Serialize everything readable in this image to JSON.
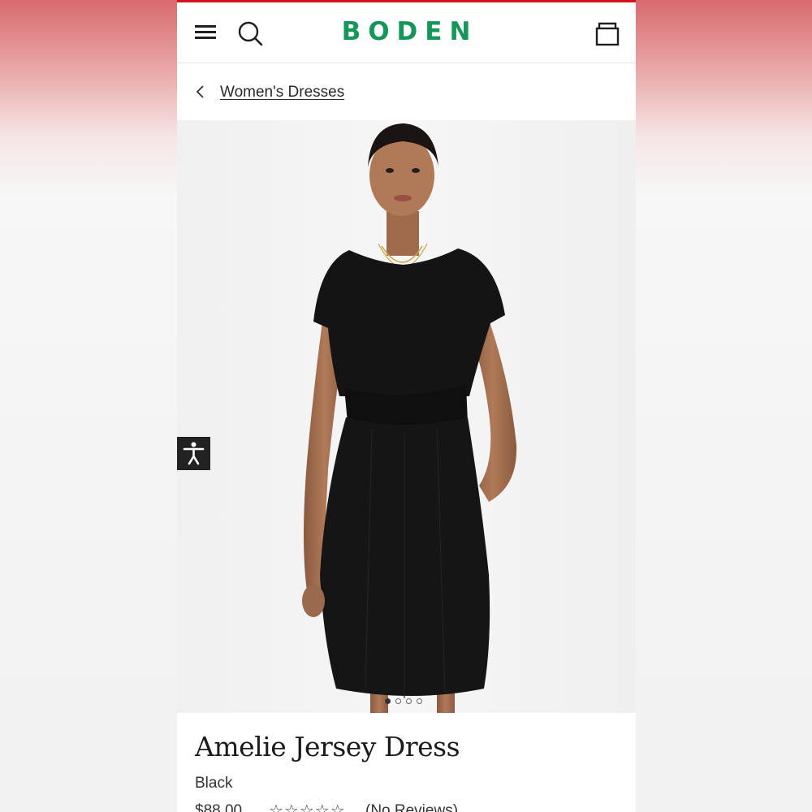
{
  "brand": {
    "logo_text": "BODEN",
    "logo_color": "#17965a",
    "accent_color": "#d3141c"
  },
  "header": {
    "menu_icon": "hamburger-menu-icon",
    "search_icon": "search-icon",
    "bag_icon": "shopping-bag-icon"
  },
  "breadcrumb": {
    "back_icon": "chevron-left-icon",
    "label": "Women's Dresses"
  },
  "gallery": {
    "image_count": 4,
    "active_index": 0
  },
  "accessibility": {
    "icon": "accessibility-person-icon"
  },
  "product": {
    "name": "Amelie Jersey Dress",
    "color": "Black",
    "price": "$88.00",
    "rating_stars": "☆☆☆☆☆",
    "reviews_label": "(No Reviews)"
  }
}
